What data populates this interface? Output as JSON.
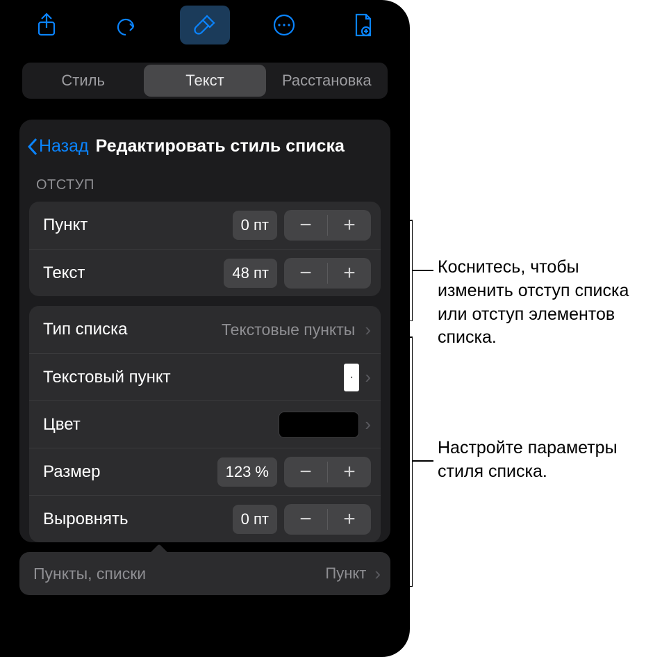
{
  "toolbar_icons": {
    "share": "share-icon",
    "undo": "undo-icon",
    "format": "paintbrush-icon",
    "more": "more-icon",
    "doc": "document-settings-icon"
  },
  "segmented": {
    "style": "Стиль",
    "text": "Текст",
    "layout": "Расстановка"
  },
  "header": {
    "back": "Назад",
    "title": "Редактировать стиль списка"
  },
  "indent": {
    "section": "ОТСТУП",
    "bullet_label": "Пункт",
    "bullet_value": "0 пт",
    "text_label": "Текст",
    "text_value": "48 пт"
  },
  "style": {
    "list_type_label": "Тип списка",
    "list_type_value": "Текстовые пункты",
    "text_bullet_label": "Текстовый пункт",
    "text_bullet_glyph": "·",
    "color_label": "Цвет",
    "size_label": "Размер",
    "size_value": "123 %",
    "align_label": "Выровнять",
    "align_value": "0 пт"
  },
  "bottom": {
    "left": "Пункты, списки",
    "right": "Пункт"
  },
  "annotations": {
    "indent_hint": "Коснитесь, чтобы изменить отступ списка или отступ элементов списка.",
    "style_hint": "Настройте параметры стиля списка."
  }
}
